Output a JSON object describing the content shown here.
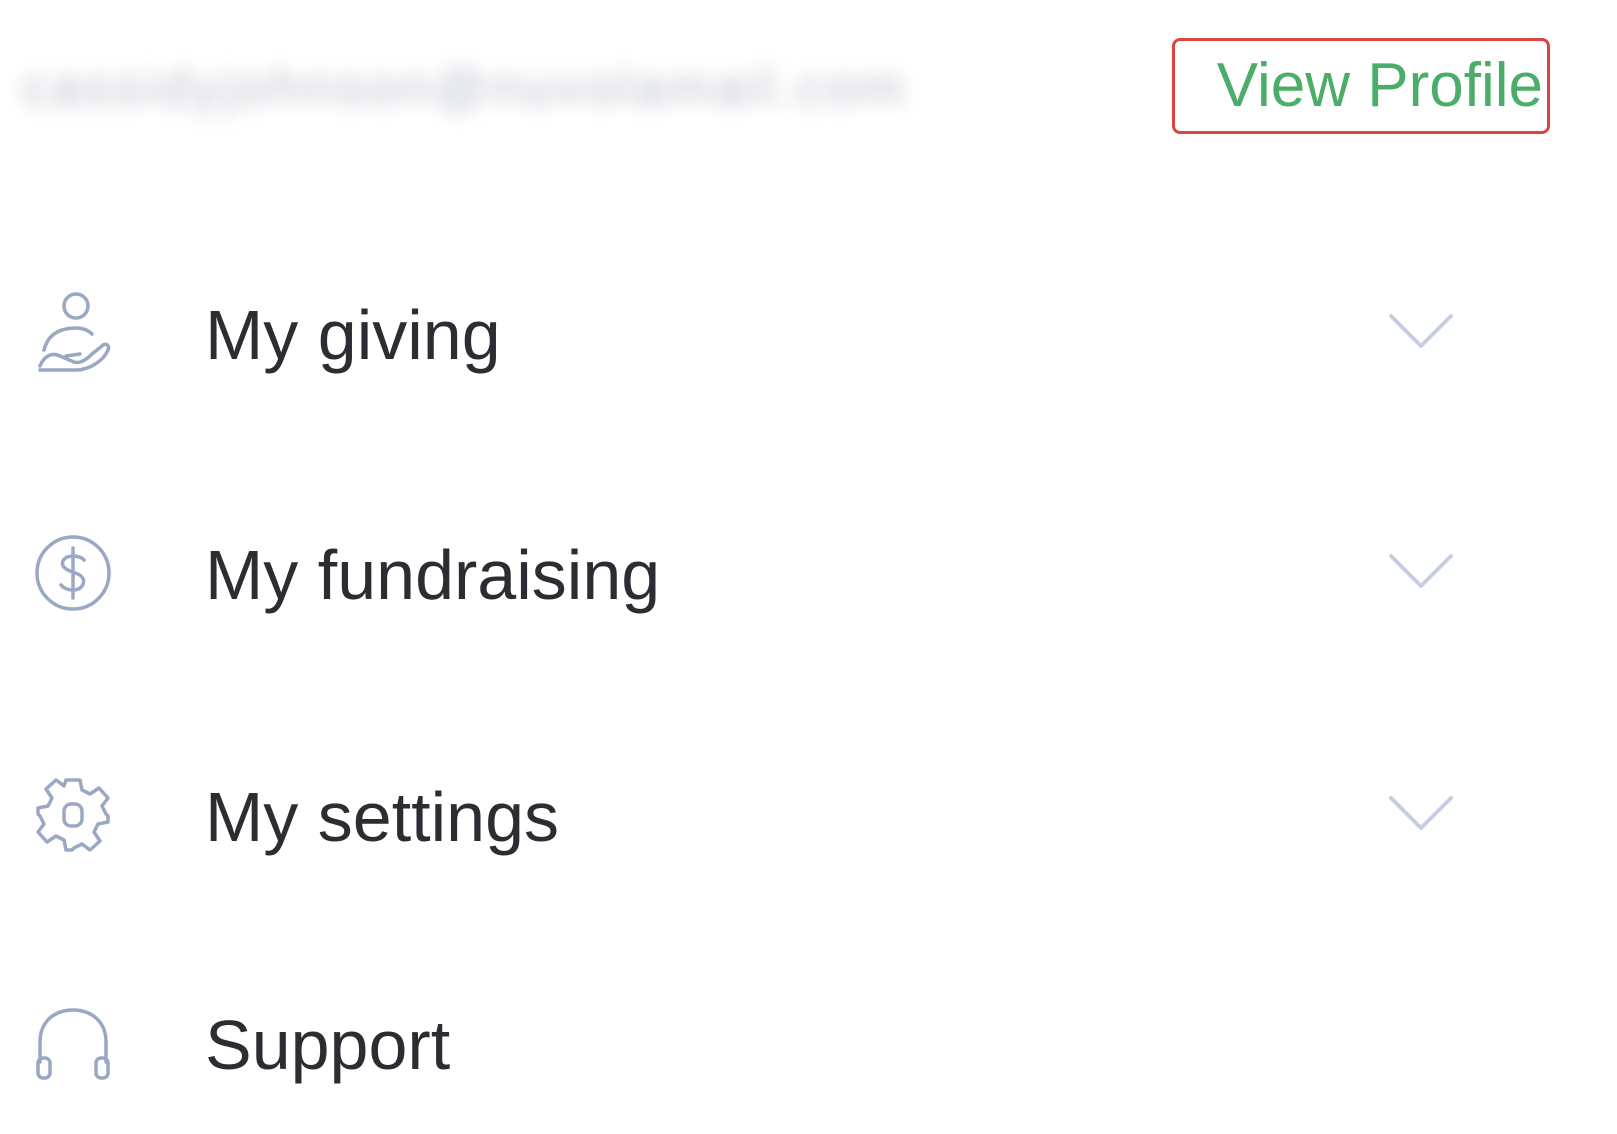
{
  "header": {
    "email": "cassidyjohnson@nuvolamail.com",
    "view_profile_label": "View Profile"
  },
  "colors": {
    "link_green": "#4cad6a",
    "highlight_border": "#d9473c",
    "icon_stroke": "#9aa8c4",
    "chevron": "#c5cfe2",
    "label_text": "#2b2d32"
  },
  "menu": {
    "items": [
      {
        "label": "My giving",
        "icon": "hand-heart-person-icon",
        "expandable": true
      },
      {
        "label": "My fundraising",
        "icon": "dollar-circle-icon",
        "expandable": true
      },
      {
        "label": "My settings",
        "icon": "gear-icon",
        "expandable": true
      },
      {
        "label": "Support",
        "icon": "headphones-icon",
        "expandable": false
      }
    ]
  }
}
